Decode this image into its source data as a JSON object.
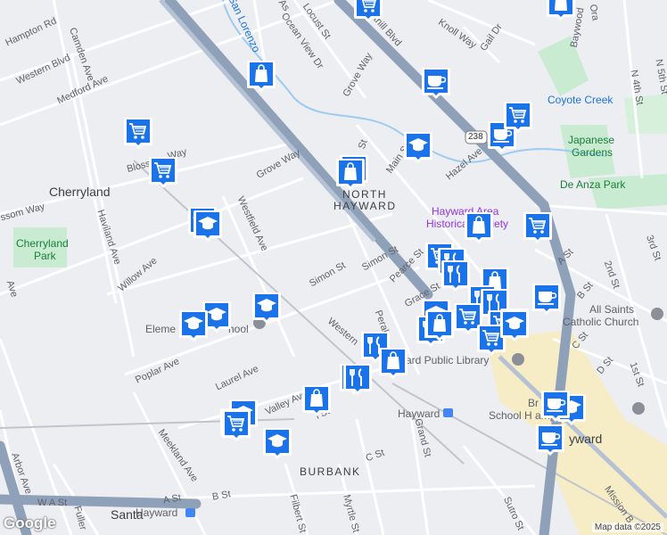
{
  "map": {
    "place_labels": {
      "cherryland": "Cherryland",
      "north_hayward_1": "NORTH",
      "north_hayward_2": "HAYWARD",
      "burbank": "BURBANK",
      "hayward_downtown": "yward",
      "santa": "Santa"
    },
    "street_labels": {
      "hampton": "Hampton Rd",
      "camden": "Camden Ave",
      "western_blvd": "Western Blvd",
      "medford": "Medford Ave",
      "blossom_way_1": "Blosso",
      "blossom_way_2": "Way",
      "blossom_left": "ssom Way",
      "haviland": "Haviland Ave",
      "ave_left": "Ave",
      "willow": "Willow Ave",
      "westfield": "Westfield Ave",
      "grove_way_1": "Grove Way",
      "grove_way_2": "Grove Way",
      "ocean_view": "Ocean View Dr",
      "locust": "Locust St",
      "as_st": "As",
      "foothill": "Foothill Blvd",
      "knoll": "Knoll Way",
      "gail": "Gail Dr",
      "baywood": "Baywood",
      "ora": "Ora",
      "main_st_1": "St",
      "main_st_2": "Main St",
      "hazel": "Hazel Ave",
      "simon_1": "Simon St",
      "simon_2": "Simon St",
      "pearce": "Pearce St",
      "grace": "Grace St",
      "peralta": "Peralt",
      "western_lower": "Western",
      "poplar": "Poplar Ave",
      "laurel": "Laurel Ave",
      "valley": "Valley Ave",
      "meekland": "Meekland Ave",
      "grand": "Grand St",
      "c_st_1": "C St",
      "c_st_2": "C St",
      "a_st_1": "A St",
      "a_st_2": "A St",
      "w_a_st": "W A St",
      "b_st_1": "B St",
      "b_st_2": "B St",
      "d_st": "D St",
      "first": "1st St",
      "second": "2nd St",
      "third": "3rd St",
      "fourth": "N 4th St",
      "fifth": "N 5th St",
      "filbert": "Filbert St",
      "myrtle": "Myrtle St",
      "sutro": "Sutro St",
      "arbor": "Arbor Ave",
      "fuller": "Fuller",
      "mission": "Mission B",
      "route_238": "238",
      "lst": "l St"
    },
    "poi_labels": {
      "san_lorenzo": "San Lorenzo",
      "coyote_creek": "Coyote Creek",
      "japanese_gardens_1": "Japanese",
      "japanese_gardens_2": "Gardens",
      "de_anza": "De Anza Park",
      "cherryland_park_1": "Cherryland",
      "cherryland_park_2": "Park",
      "hayward_area_1": "Hayward Area",
      "hayward_area_2": "Historical Society",
      "all_saints_1": "All Saints",
      "all_saints_2": "Catholic Church",
      "public_library": "ard Public Library",
      "middle_school_1": "Br    Middle",
      "middle_school_2": "School H    ampus",
      "elementary": "Eleme       nd",
      "elementary_2": "hool",
      "hayward_station": "Hayward",
      "hayward_amtrak": "Hayward"
    },
    "attribution": {
      "logo": "Google",
      "map_data": "Map data ©2025"
    },
    "colors": {
      "background": "#eceef2",
      "highway": "#8fa1b9",
      "marker_fill": "#1a73e8",
      "park": "#c8ebd1",
      "water": "#9ecbf0",
      "downtown": "#f6ecc6"
    },
    "markers": [
      {
        "id": "m1",
        "icon": "shopping-bag"
      },
      {
        "id": "m2",
        "icon": "shopping-cart"
      },
      {
        "id": "m3",
        "icon": "coffee"
      },
      {
        "id": "m4",
        "icon": "shopping-bag"
      },
      {
        "id": "m5",
        "icon": "coffee"
      },
      {
        "id": "m6",
        "icon": "shopping-cart"
      },
      {
        "id": "m7",
        "icon": "shopping-cart"
      },
      {
        "id": "m8",
        "icon": "shopping-cart"
      },
      {
        "id": "m9",
        "icon": "graduation-cap"
      },
      {
        "id": "m10",
        "icon": "shopping-bag"
      },
      {
        "id": "m11",
        "icon": "shopping-bag"
      },
      {
        "id": "m12",
        "icon": "graduation-cap"
      },
      {
        "id": "m13",
        "icon": "graduation-cap"
      },
      {
        "id": "m14",
        "icon": "shopping-bag"
      },
      {
        "id": "m15",
        "icon": "shopping-cart"
      },
      {
        "id": "m16",
        "icon": "shopping-cart"
      },
      {
        "id": "m17",
        "icon": "utensils"
      },
      {
        "id": "m18",
        "icon": "utensils"
      },
      {
        "id": "m19",
        "icon": "shopping-bag"
      },
      {
        "id": "m20",
        "icon": "coffee"
      },
      {
        "id": "m21",
        "icon": "graduation-cap"
      },
      {
        "id": "m22",
        "icon": "graduation-cap"
      },
      {
        "id": "m23",
        "icon": "graduation-cap"
      },
      {
        "id": "m24",
        "icon": "utensils"
      },
      {
        "id": "m25",
        "icon": "utensils"
      },
      {
        "id": "m26",
        "icon": "shopping-cart"
      },
      {
        "id": "m27",
        "icon": "graduation-cap"
      },
      {
        "id": "m28",
        "icon": "shopping-cart"
      },
      {
        "id": "m29",
        "icon": "utensils"
      },
      {
        "id": "m30",
        "icon": "shopping-bag"
      },
      {
        "id": "m31",
        "icon": "utensils"
      },
      {
        "id": "m32",
        "icon": "shopping-bag"
      },
      {
        "id": "m33",
        "icon": "shopping-cart"
      },
      {
        "id": "m34",
        "icon": "shopping-cart"
      },
      {
        "id": "m35",
        "icon": "graduation-cap"
      },
      {
        "id": "m36",
        "icon": "coffee"
      },
      {
        "id": "m37",
        "icon": "graduation-cap"
      },
      {
        "id": "m38",
        "icon": "coffee"
      }
    ]
  }
}
